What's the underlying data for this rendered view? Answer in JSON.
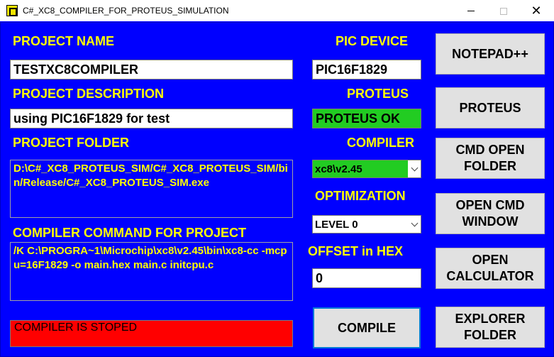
{
  "window": {
    "title": "C#_XC8_COMPILER_FOR_PROTEUS_SIMULATION",
    "minimize_icon": "minimize-icon",
    "maximize_icon": "maximize-icon",
    "close_glyph": "✕"
  },
  "project": {
    "name_label": "PROJECT NAME",
    "name_value": "TESTXC8COMPILER",
    "description_label": "PROJECT DESCRIPTION",
    "description_value": "using PIC16F1829 for test",
    "folder_label": "PROJECT FOLDER",
    "folder_value": "D:\\C#_XC8_PROTEUS_SIM/C#_XC8_PROTEUS_SIM/bin/Release/C#_XC8_PROTEUS_SIM.exe",
    "command_label": "COMPILER COMMAND FOR PROJECT",
    "command_value": "/K C:\\PROGRA~1\\Microchip\\xc8\\v2.45\\bin\\xc8-cc -mcpu=16F1829 -o main.hex main.c initcpu.c",
    "status_value": "COMPILER IS STOPED"
  },
  "settings": {
    "device_label": "PIC DEVICE",
    "device_value": "PIC16F1829",
    "proteus_label": "PROTEUS",
    "proteus_value": "PROTEUS OK",
    "compiler_label": "COMPILER",
    "compiler_value": "xc8\\v2.45",
    "optimization_label": "OPTIMIZATION",
    "optimization_value": "LEVEL 0",
    "offset_label": "OFFSET in HEX",
    "offset_value": "0",
    "compile_button": "COMPILE"
  },
  "buttons": {
    "notepad": "NOTEPAD++",
    "proteus": "PROTEUS",
    "cmd_open_folder": "CMD OPEN FOLDER",
    "open_cmd_window": "OPEN CMD WINDOW",
    "open_calculator": "OPEN CALCULATOR",
    "explorer_folder": "EXPLORER FOLDER"
  },
  "colors": {
    "background": "#0000ff",
    "label": "#ffff00",
    "status_stopped": "#ff0000",
    "status_ok": "#22cc22"
  }
}
